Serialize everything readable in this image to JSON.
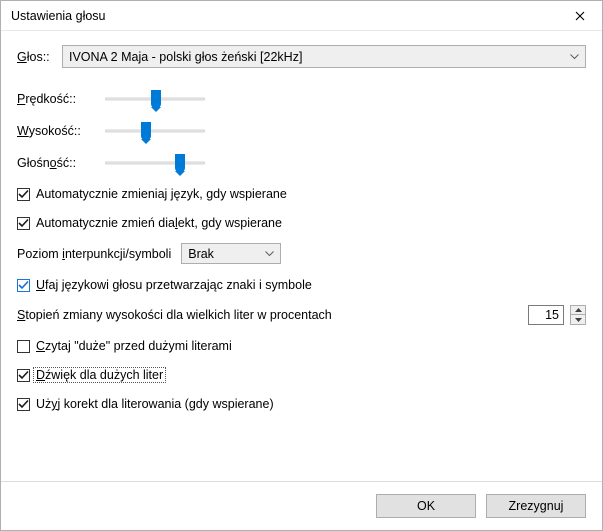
{
  "window": {
    "title": "Ustawienia głosu"
  },
  "voice": {
    "label": "Głos::",
    "selected": "IVONA 2 Maja - polski głos żeński [22kHz]"
  },
  "sliders": {
    "speed": {
      "label": "Prędkość::",
      "percent": 48
    },
    "pitch": {
      "label": "Wysokość::",
      "percent": 38
    },
    "volume": {
      "label": "Głośność::",
      "percent": 72
    }
  },
  "checks": {
    "auto_lang": {
      "label": "Automatycznie zmieniaj język, gdy wspierane",
      "checked": true
    },
    "auto_dialect": {
      "label": "Automatycznie zmień dialekt, gdy wspierane",
      "checked": true
    },
    "trust_lang": {
      "label": "Ufaj językowi głosu przetwarzając znaki i symbole",
      "checked": true
    },
    "say_cap": {
      "label": "Czytaj \"duże\" przed dużymi literami",
      "checked": false
    },
    "beep_cap": {
      "label": "Dźwięk dla dużych liter",
      "checked": true
    },
    "spell_fix": {
      "label": "Użyj korekt dla literowania (gdy wspierane)",
      "checked": true
    }
  },
  "punctuation": {
    "label": "Poziom interpunkcji/symboli",
    "selected": "Brak"
  },
  "capital_pitch": {
    "label": "Stopień zmiany wysokości dla wielkich liter w procentach",
    "value": "15"
  },
  "buttons": {
    "ok": "OK",
    "cancel": "Zrezygnuj"
  },
  "colors": {
    "accent": "#007ad9",
    "border": "#adadad",
    "button_bg": "#e1e1e1"
  }
}
